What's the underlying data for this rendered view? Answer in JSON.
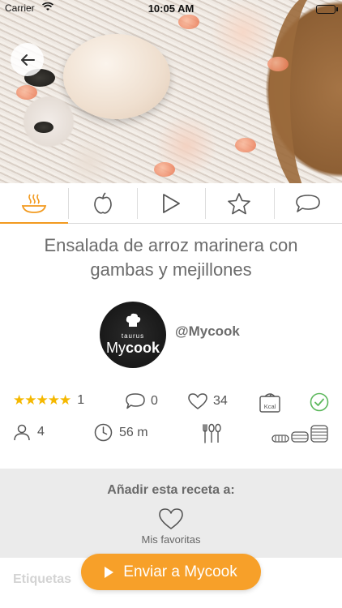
{
  "status_bar": {
    "carrier": "Carrier",
    "time": "10:05 AM",
    "wifi_icon": "wifi-icon",
    "battery_icon": "battery-icon"
  },
  "tabs": [
    {
      "icon": "cooking-pot-icon",
      "active": true
    },
    {
      "icon": "apple-icon",
      "active": false
    },
    {
      "icon": "play-icon",
      "active": false
    },
    {
      "icon": "star-icon",
      "active": false
    },
    {
      "icon": "chat-bubble-icon",
      "active": false
    }
  ],
  "recipe": {
    "title": "Ensalada de arroz marinera con gambas y mejillones",
    "author_handle": "@Mycook",
    "avatar_text_small": "taurus",
    "avatar_text_big_1": "My",
    "avatar_text_big_2": "cook"
  },
  "stats": {
    "rating_stars": "★★★★★",
    "rating_count": "1",
    "comments_count": "0",
    "likes_count": "34",
    "kcal_label": "Kcal"
  },
  "meta": {
    "servings": "4",
    "time": "56 m"
  },
  "add_section": {
    "label": "Añadir esta receta a:",
    "favorites": "Mis favoritas"
  },
  "tags_title": "Etiquetas",
  "send_button": "Enviar a Mycook",
  "colors": {
    "accent": "#f7a029",
    "stars": "#f5b800",
    "check": "#5cb85c"
  }
}
